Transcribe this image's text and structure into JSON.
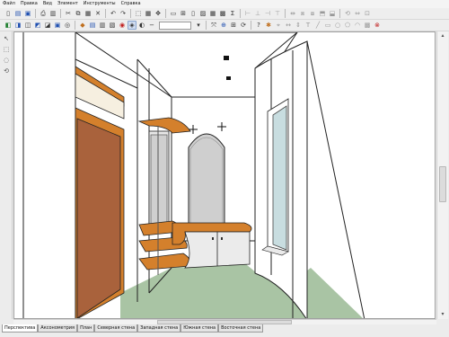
{
  "menu": [
    "Файл",
    "Правка",
    "Вид",
    "Элемент",
    "Инструменты",
    "Справка"
  ],
  "toolbar": {
    "zoom_value": "",
    "sum_symbol": "Σ"
  },
  "tabs": [
    {
      "label": "Перспектива",
      "active": true
    },
    {
      "label": "Аксонометрия",
      "active": false
    },
    {
      "label": "План",
      "active": false
    },
    {
      "label": "Северная стена",
      "active": false
    },
    {
      "label": "Западная стена",
      "active": false
    },
    {
      "label": "Южная стена",
      "active": false
    },
    {
      "label": "Восточная стена",
      "active": false
    }
  ],
  "colors": {
    "wood": "#d4802c",
    "door": "#a9623c",
    "floor": "#a9c4a4",
    "wall": "#ffffff",
    "mirror": "#cfcfcf",
    "window_glass": "#c8dde0"
  }
}
